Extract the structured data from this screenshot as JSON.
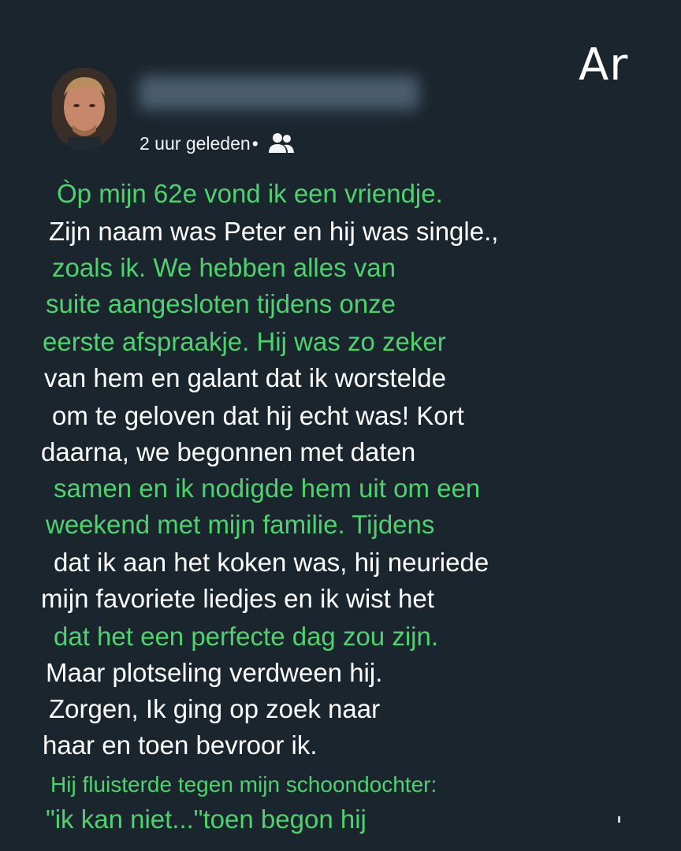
{
  "post": {
    "timestamp": "2 uur geleden",
    "separator": "•",
    "audience_icon": "friends-icon",
    "author_name_blurred": true
  },
  "brand": {
    "logo_text": "Ar"
  },
  "story": {
    "lines": [
      "Òp mijn 62e vond ik een vriendje.",
      "Zijn naam was Peter en hij was single.,",
      "zoals ik. We hebben alles van",
      "suite aangesloten tijdens onze",
      "eerste afspraakje. Hij was zo zeker",
      "van hem en galant dat ik worstelde",
      "om te geloven dat hij echt was! Kort",
      "daarna, we begonnen met daten",
      "samen en ik nodigde hem uit om een",
      "weekend met mijn familie. Tijdens",
      "dat ik aan het koken was, hij neuriede",
      "mijn favoriete liedjes en ik wist het",
      "dat het een perfecte dag zou zijn.",
      "Maar plotseling verdween hij.",
      "Zorgen, Ik ging op zoek naar",
      "haar en toen bevroor ik.",
      "Hij fluisterde tegen mijn schoondochter:",
      "\"ik kan niet...\"toen begon hij"
    ]
  },
  "colors": {
    "background": "#1b252e",
    "green_text": "#4ed26e",
    "white_text": "#ffffff"
  }
}
